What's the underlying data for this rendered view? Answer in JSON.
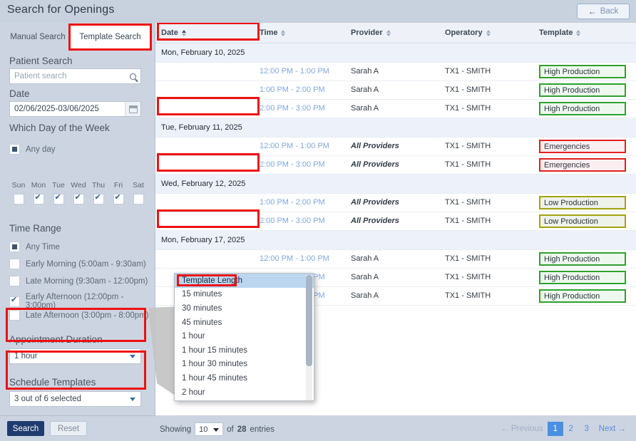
{
  "window": {
    "title": "Search for Openings",
    "back_label": "Back",
    "back_icon": "arrow-left-icon"
  },
  "sidebar": {
    "tabs": [
      {
        "label": "Manual Search",
        "active": false
      },
      {
        "label": "Template Search",
        "active": true
      }
    ],
    "patient_search": {
      "label": "Patient Search",
      "placeholder": "Patient search",
      "value": "",
      "icon": "search-icon"
    },
    "date": {
      "label": "Date",
      "value": "02/06/2025-03/06/2025",
      "icon": "calendar-icon"
    },
    "day_of_week": {
      "label": "Which Day of the Week",
      "any_day_label": "Any day",
      "any_day_state": "partial",
      "days": [
        {
          "name": "Sun",
          "checked": false
        },
        {
          "name": "Mon",
          "checked": true
        },
        {
          "name": "Tue",
          "checked": true
        },
        {
          "name": "Wed",
          "checked": true
        },
        {
          "name": "Thu",
          "checked": true
        },
        {
          "name": "Fri",
          "checked": true
        },
        {
          "name": "Sat",
          "checked": false
        }
      ]
    },
    "time_range": {
      "label": "Time Range",
      "options": [
        {
          "label": "Any Time",
          "state": "partial"
        },
        {
          "label": "Early Morning (5:00am - 9:30am)",
          "state": "unchecked"
        },
        {
          "label": "Late Morning (9:30am - 12:00pm)",
          "state": "unchecked"
        },
        {
          "label": "Early Afternoon (12:00pm - 3:00pm)",
          "state": "checked"
        },
        {
          "label": "Late Afternoon (3:00pm - 8:00pm)",
          "state": "unchecked"
        }
      ]
    },
    "appointment_duration": {
      "label": "Appointment Duration",
      "value": "1 hour"
    },
    "schedule_templates": {
      "label": "Schedule Templates",
      "value": "3 out of 6 selected"
    }
  },
  "dropdown_popup": {
    "items": [
      {
        "label": "Template Length",
        "selected": true
      },
      {
        "label": "15 minutes",
        "selected": false
      },
      {
        "label": "30 minutes",
        "selected": false
      },
      {
        "label": "45 minutes",
        "selected": false
      },
      {
        "label": "1 hour",
        "selected": false
      },
      {
        "label": "1 hour 15 minutes",
        "selected": false
      },
      {
        "label": "1 hour 30 minutes",
        "selected": false
      },
      {
        "label": "1 hour 45 minutes",
        "selected": false
      },
      {
        "label": "2 hour",
        "selected": false
      }
    ]
  },
  "table": {
    "columns": [
      {
        "label": "Date",
        "sort": "asc"
      },
      {
        "label": "Time",
        "sort": "none"
      },
      {
        "label": "Provider",
        "sort": "none"
      },
      {
        "label": "Operatory",
        "sort": "none"
      },
      {
        "label": "Template",
        "sort": "none"
      }
    ],
    "rows": [
      {
        "type": "group",
        "date": "Mon, February 10, 2025",
        "highlight": true
      },
      {
        "type": "data",
        "time": "12:00 PM - 1:00 PM",
        "provider": "Sarah A",
        "provider_all": false,
        "operatory": "TX1 - SMITH",
        "template": "High Production",
        "template_color": "green"
      },
      {
        "type": "data",
        "time": "1:00 PM - 2:00 PM",
        "provider": "Sarah A",
        "provider_all": false,
        "operatory": "TX1 - SMITH",
        "template": "High Production",
        "template_color": "green"
      },
      {
        "type": "data",
        "time": "2:00 PM - 3:00 PM",
        "provider": "Sarah A",
        "provider_all": false,
        "operatory": "TX1 - SMITH",
        "template": "High Production",
        "template_color": "green"
      },
      {
        "type": "group",
        "date": "Tue, February 11, 2025",
        "highlight": true
      },
      {
        "type": "data",
        "time": "12:00 PM - 1:00 PM",
        "provider": "All Providers",
        "provider_all": true,
        "operatory": "TX1 - SMITH",
        "template": "Emergencies",
        "template_color": "red"
      },
      {
        "type": "data",
        "time": "2:00 PM - 3:00 PM",
        "provider": "All Providers",
        "provider_all": true,
        "operatory": "TX1 - SMITH",
        "template": "Emergencies",
        "template_color": "red"
      },
      {
        "type": "group",
        "date": "Wed, February 12, 2025",
        "highlight": true
      },
      {
        "type": "data",
        "time": "1:00 PM - 2:00 PM",
        "provider": "All Providers",
        "provider_all": true,
        "operatory": "TX1 - SMITH",
        "template": "Low Production",
        "template_color": "olive"
      },
      {
        "type": "data",
        "time": "2:00 PM - 3:00 PM",
        "provider": "All Providers",
        "provider_all": true,
        "operatory": "TX1 - SMITH",
        "template": "Low Production",
        "template_color": "olive"
      },
      {
        "type": "group",
        "date": "Mon, February 17, 2025",
        "highlight": true
      },
      {
        "type": "data",
        "time": "12:00 PM - 1:00 PM",
        "provider": "Sarah A",
        "provider_all": false,
        "operatory": "TX1 - SMITH",
        "template": "High Production",
        "template_color": "green"
      },
      {
        "type": "data",
        "time": "1:00 PM - 2:00 PM",
        "provider": "Sarah A",
        "provider_all": false,
        "operatory": "TX1 - SMITH",
        "template": "High Production",
        "template_color": "green"
      },
      {
        "type": "data",
        "time": "2:00 PM - 3:00 PM",
        "provider": "Sarah A",
        "provider_all": false,
        "operatory": "TX1 - SMITH",
        "template": "High Production",
        "template_color": "green"
      }
    ]
  },
  "footer": {
    "search_label": "Search",
    "reset_label": "Reset",
    "showing_prefix": "Showing",
    "page_size": "10",
    "showing_middle": "of",
    "entries_count": "28",
    "showing_suffix": "entries",
    "previous_label": "Previous",
    "next_label": "Next",
    "pages": [
      "1",
      "2",
      "3"
    ],
    "active_page": "1"
  },
  "colors": {
    "accent": "#1f3c6e",
    "highlight": "#ee1111",
    "green": "#2fa12f",
    "red": "#e02020",
    "olive": "#a3a310",
    "link": "#5b8ede"
  }
}
